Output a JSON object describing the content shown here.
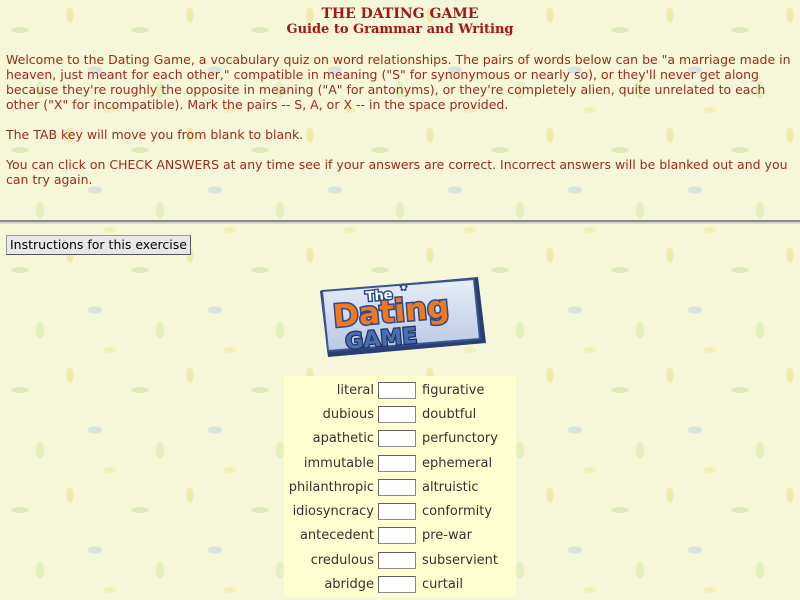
{
  "header": {
    "title": "THE DATING GAME",
    "subtitle": "Guide to Grammar and Writing"
  },
  "intro": {
    "paragraph1": "Welcome to the Dating Game, a vocabulary quiz on word relationships. The pairs of words below can be \"a marriage made in heaven, just meant for each other,\" compatible in meaning (\"S\" for synonymous or nearly so), or they'll never get along because they're roughly the opposite in meaning (\"A\" for antonyms), or they're completely alien, quite unrelated to each other (\"X\" for incompatible). Mark the pairs -- S, A, or X -- in the space provided.",
    "paragraph2": "The TAB key will move you from blank to blank.",
    "paragraph3": "You can click on CHECK ANSWERS at any time see if your answers are correct. Incorrect answers will be blanked out and you can try again."
  },
  "instructions_button": "Instructions for this exercise",
  "logo": {
    "word_the": "The",
    "word_dating": "Dating",
    "word_game": "GAME"
  },
  "pairs": [
    {
      "left": "literal",
      "right": "figurative",
      "answer": ""
    },
    {
      "left": "dubious",
      "right": "doubtful",
      "answer": ""
    },
    {
      "left": "apathetic",
      "right": "perfunctory",
      "answer": ""
    },
    {
      "left": "immutable",
      "right": "ephemeral",
      "answer": ""
    },
    {
      "left": "philanthropic",
      "right": "altruistic",
      "answer": ""
    },
    {
      "left": "idiosyncracy",
      "right": "conformity",
      "answer": ""
    },
    {
      "left": "antecedent",
      "right": "pre-war",
      "answer": ""
    },
    {
      "left": "credulous",
      "right": "subservient",
      "answer": ""
    },
    {
      "left": "abridge",
      "right": "curtail",
      "answer": ""
    }
  ],
  "colors": {
    "heading": "#a01818",
    "body_text": "#9b2a1c",
    "quiz_background": "#ffffd0",
    "logo_blue": "#4a6fb0",
    "logo_orange": "#f07820"
  }
}
